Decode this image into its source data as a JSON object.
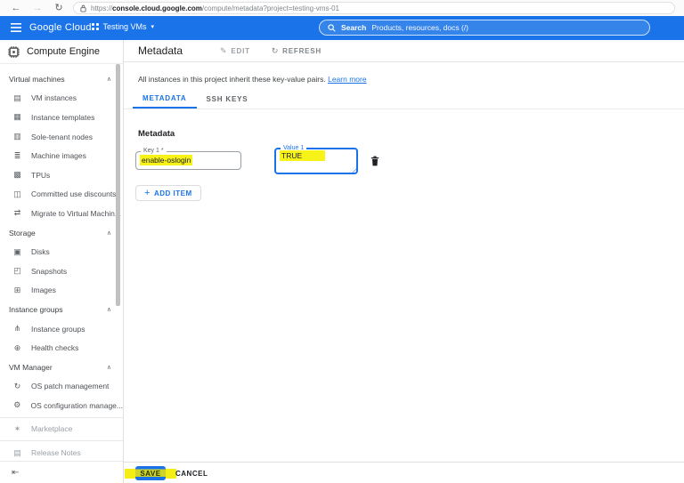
{
  "colors": {
    "accent": "#1a73e8",
    "header_bg": "#1a73e8",
    "highlight": "#f7f218"
  },
  "browser": {
    "url_scheme": "https://",
    "url_host": "console.cloud.google.com",
    "url_path": "/compute/metadata?project=testing-vms-01"
  },
  "header": {
    "logo_text": "Google Cloud",
    "project_name": "Testing VMs",
    "search_label": "Search",
    "search_placeholder": "Products, resources, docs (/)"
  },
  "sidebar": {
    "product_name": "Compute Engine",
    "sections": [
      {
        "label": "Virtual machines",
        "items": [
          {
            "label": "VM instances",
            "icon": "vm-instances-icon"
          },
          {
            "label": "Instance templates",
            "icon": "instance-templates-icon"
          },
          {
            "label": "Sole-tenant nodes",
            "icon": "sole-tenant-nodes-icon"
          },
          {
            "label": "Machine images",
            "icon": "machine-images-icon"
          },
          {
            "label": "TPUs",
            "icon": "tpus-icon"
          },
          {
            "label": "Committed use discounts",
            "icon": "committed-use-discounts-icon"
          },
          {
            "label": "Migrate to Virtual Machin...",
            "icon": "migrate-icon"
          }
        ]
      },
      {
        "label": "Storage",
        "items": [
          {
            "label": "Disks",
            "icon": "disks-icon"
          },
          {
            "label": "Snapshots",
            "icon": "snapshots-icon"
          },
          {
            "label": "Images",
            "icon": "images-icon"
          }
        ]
      },
      {
        "label": "Instance groups",
        "items": [
          {
            "label": "Instance groups",
            "icon": "instance-groups-icon"
          },
          {
            "label": "Health checks",
            "icon": "health-checks-icon"
          }
        ]
      },
      {
        "label": "VM Manager",
        "items": [
          {
            "label": "OS patch management",
            "icon": "os-patch-icon"
          },
          {
            "label": "OS configuration manage...",
            "icon": "os-config-icon"
          }
        ]
      }
    ],
    "footer_items": [
      {
        "label": "Marketplace",
        "icon": "marketplace-icon",
        "disabled": true
      },
      {
        "label": "Release Notes",
        "icon": "release-notes-icon",
        "disabled": true
      }
    ]
  },
  "page": {
    "title": "Metadata",
    "edit_label": "EDIT",
    "refresh_label": "REFRESH",
    "description": "All instances in this project inherit these key-value pairs.",
    "learn_more_label": "Learn more",
    "tabs": [
      {
        "label": "METADATA"
      },
      {
        "label": "SSH KEYS"
      }
    ],
    "section_title": "Metadata",
    "form": {
      "key_label": "Key 1 *",
      "key_value": "enable-oslogin",
      "value_label": "Value 1",
      "value_value": "TRUE"
    },
    "add_item_label": "ADD ITEM",
    "save_label": "SAVE",
    "cancel_label": "CANCEL"
  }
}
